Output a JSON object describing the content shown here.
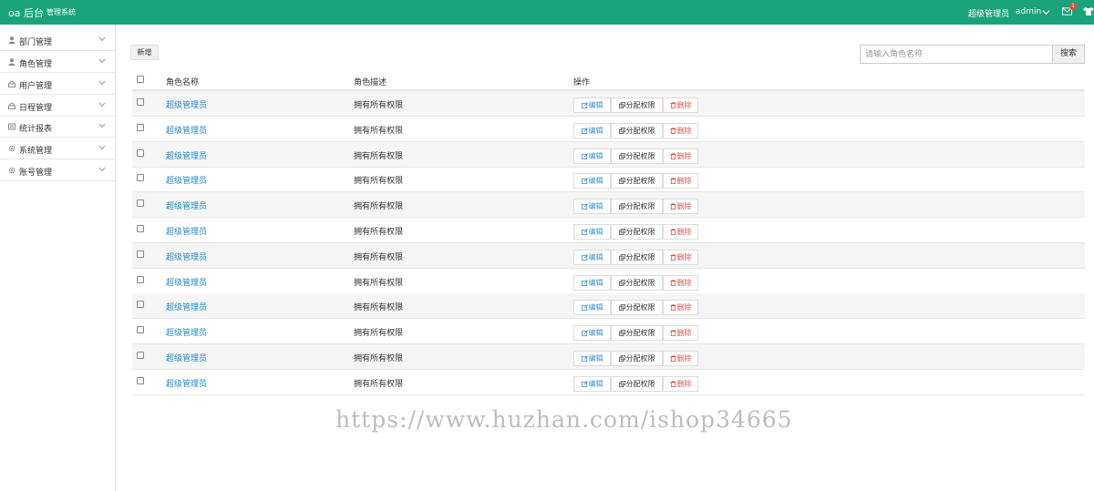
{
  "header": {
    "brand": "oa 后台",
    "subtitle": "管理系统",
    "user_role": "超级管理员",
    "user_name": "admin",
    "notification_count": "1"
  },
  "sidebar": {
    "items": [
      {
        "label": "部门管理",
        "icon": "user-icon"
      },
      {
        "label": "角色管理",
        "icon": "user-icon"
      },
      {
        "label": "用户管理",
        "icon": "lock-icon"
      },
      {
        "label": "日程管理",
        "icon": "lock-icon"
      },
      {
        "label": "统计报表",
        "icon": "chart-icon"
      },
      {
        "label": "系统管理",
        "icon": "gear-icon"
      },
      {
        "label": "账号管理",
        "icon": "gear-icon"
      }
    ]
  },
  "toolbar": {
    "add_label": "新增",
    "search_placeholder": "请输入角色名称",
    "search_label": "搜索"
  },
  "table": {
    "headers": {
      "name": "角色名称",
      "desc": "角色描述",
      "actions": "操作"
    },
    "actions": {
      "edit": "编辑",
      "assign": "分配权限",
      "delete": "删除"
    },
    "rows": [
      {
        "name": "超级管理员",
        "desc": "拥有所有权限"
      },
      {
        "name": "超级管理员",
        "desc": "拥有所有权限"
      },
      {
        "name": "超级管理员",
        "desc": "拥有所有权限"
      },
      {
        "name": "超级管理员",
        "desc": "拥有所有权限"
      },
      {
        "name": "超级管理员",
        "desc": "拥有所有权限"
      },
      {
        "name": "超级管理员",
        "desc": "拥有所有权限"
      },
      {
        "name": "超级管理员",
        "desc": "拥有所有权限"
      },
      {
        "name": "超级管理员",
        "desc": "拥有所有权限"
      },
      {
        "name": "超级管理员",
        "desc": "拥有所有权限"
      },
      {
        "name": "超级管理员",
        "desc": "拥有所有权限"
      },
      {
        "name": "超级管理员",
        "desc": "拥有所有权限"
      },
      {
        "name": "超级管理员",
        "desc": "拥有所有权限"
      }
    ]
  },
  "watermark": "https://www.huzhan.com/ishop34665",
  "colors": {
    "header": "#1aa37a",
    "link": "#1e88c8",
    "delete": "#d9534f",
    "edit": "#3a8fcf"
  }
}
